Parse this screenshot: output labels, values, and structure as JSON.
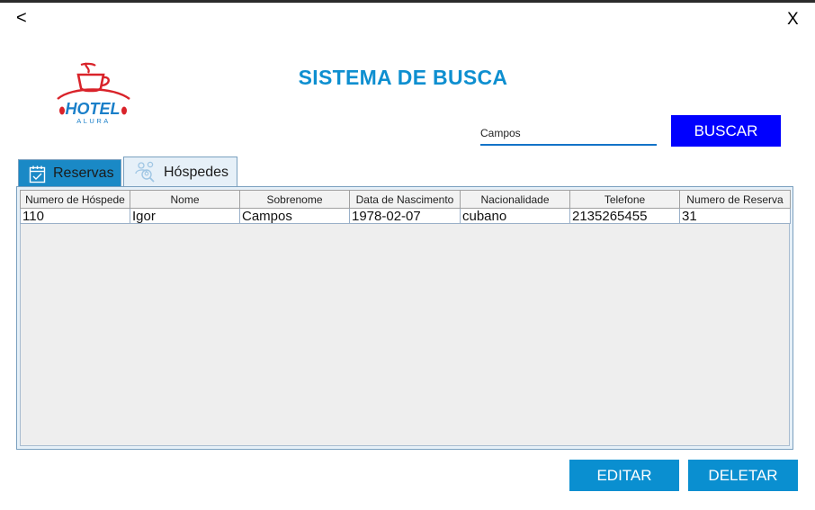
{
  "window": {
    "back_label": "<",
    "close_label": "X"
  },
  "logo": {
    "text_main": "HOTEL",
    "text_sub": "ALURA",
    "icon": "coffee-cup-icon"
  },
  "page": {
    "title": "SISTEMA DE BUSCA"
  },
  "search": {
    "value": "Campos",
    "button_label": "BUSCAR"
  },
  "tabs": [
    {
      "label": "Reservas",
      "icon": "calendar-icon"
    },
    {
      "label": "Hóspedes",
      "icon": "guests-search-icon",
      "selected": true
    }
  ],
  "table": {
    "columns": [
      "Numero de Hóspede",
      "Nome",
      "Sobrenome",
      "Data de Nascimento",
      "Nacionalidade",
      "Telefone",
      "Numero de Reserva"
    ],
    "rows": [
      [
        "110",
        "Igor",
        "Campos",
        "1978-02-07",
        "cubano",
        "2135265455",
        "31"
      ]
    ]
  },
  "actions": {
    "edit_label": "EDITAR",
    "delete_label": "DELETAR"
  },
  "colors": {
    "accent": "#0a8fd0",
    "search_button": "#0000ff",
    "title": "#0e8fd0",
    "logo_red": "#d9232a",
    "tab_active_bg": "#1a89c6"
  }
}
